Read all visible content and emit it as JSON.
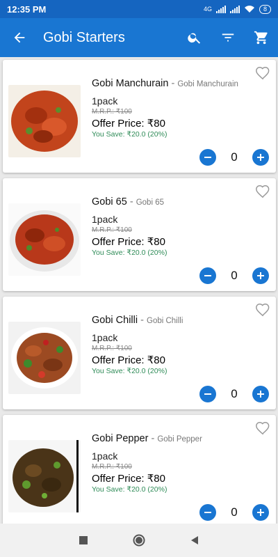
{
  "status": {
    "time": "12:35 PM",
    "network": "4G",
    "battery": "8"
  },
  "header": {
    "title": "Gobi Starters"
  },
  "products": [
    {
      "name": "Gobi Manchurain",
      "subtitle": "Gobi Manchurain",
      "pack": "1pack",
      "mrp": "M.R.P.: ₹100",
      "offer": "Offer Price: ₹80",
      "save": "You Save: ₹20.0 (20%)",
      "qty": "0"
    },
    {
      "name": "Gobi 65",
      "subtitle": "Gobi 65",
      "pack": "1pack",
      "mrp": "M.R.P.: ₹100",
      "offer": "Offer Price: ₹80",
      "save": "You Save: ₹20.0 (20%)",
      "qty": "0"
    },
    {
      "name": "Gobi Chilli",
      "subtitle": "Gobi Chilli",
      "pack": "1pack",
      "mrp": "M.R.P.: ₹100",
      "offer": "Offer Price: ₹80",
      "save": "You Save: ₹20.0 (20%)",
      "qty": "0"
    },
    {
      "name": "Gobi Pepper",
      "subtitle": "Gobi Pepper",
      "pack": "1pack",
      "mrp": "M.R.P.: ₹100",
      "offer": "Offer Price: ₹80",
      "save": "You Save: ₹20.0 (20%)",
      "qty": "0"
    }
  ],
  "colors": {
    "primary": "#1976d2",
    "status_bar": "#1565c0",
    "savings": "#2e8b57"
  },
  "icons": {
    "back": "arrow-back-icon",
    "search": "search-icon",
    "filter": "filter-icon",
    "cart": "cart-icon",
    "wishlist": "heart-outline-icon",
    "minus": "minus-icon",
    "plus": "plus-icon"
  }
}
